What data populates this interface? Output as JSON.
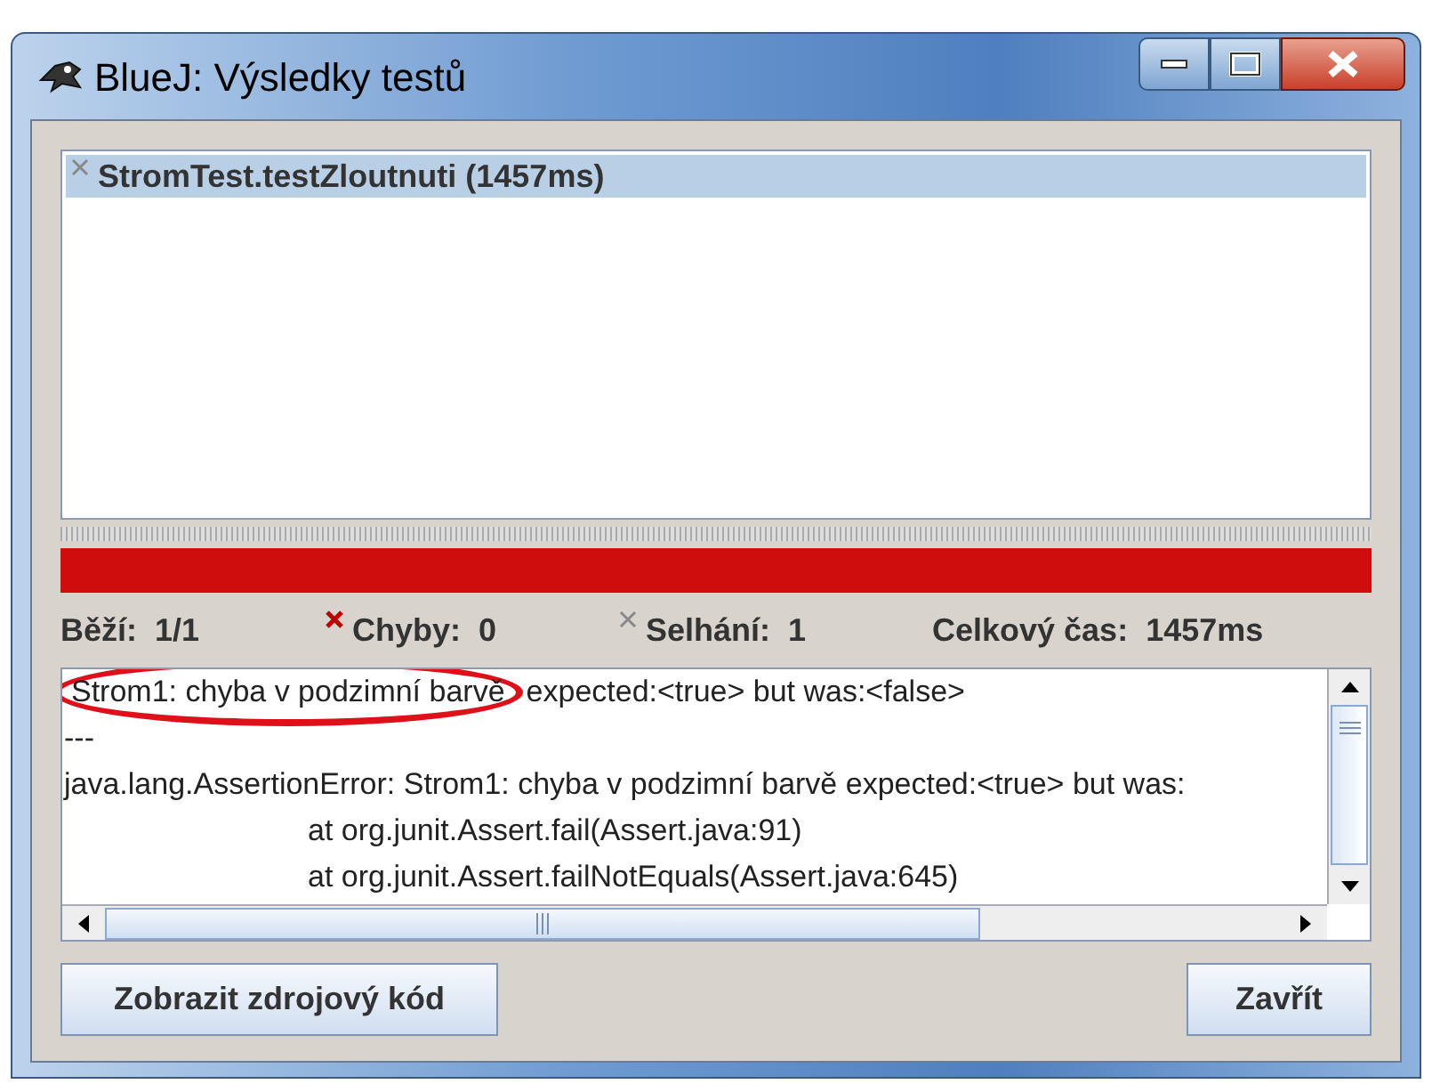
{
  "window": {
    "title": "BlueJ:  Výsledky testů"
  },
  "tests": [
    {
      "name": "StromTest.testZloutnuti (1457ms)",
      "selected": true,
      "kind": "failure"
    }
  ],
  "progress": {
    "level": 1,
    "failed": true
  },
  "stats": [
    {
      "label": "Běží:",
      "value": "1/1"
    },
    {
      "label": "Chyby:",
      "value": "0",
      "kind": "error"
    },
    {
      "label": "Selhání:",
      "value": "1",
      "kind": "failure"
    },
    {
      "label": "Celkový čas:",
      "value": "1457ms"
    }
  ],
  "trace": {
    "lines": [
      {
        "highlight": "Strom1: chyba v podzimní barvě",
        "text": "expected:<true> but was:<false>",
        "indented": false
      },
      {
        "text": "---",
        "indented": false
      },
      {
        "text": "java.lang.AssertionError: Strom1: chyba v podzimní barvě expected:<true> but was:",
        "indented": false
      },
      {
        "text": "at org.junit.Assert.fail(Assert.java:91)",
        "indented": true
      },
      {
        "text": "at org.junit.Assert.failNotEquals(Assert.java:645)",
        "indented": true
      }
    ]
  },
  "buttons": [
    {
      "label": "Zobrazit zdrojový kód"
    },
    {
      "label": "Zavřít"
    }
  ]
}
